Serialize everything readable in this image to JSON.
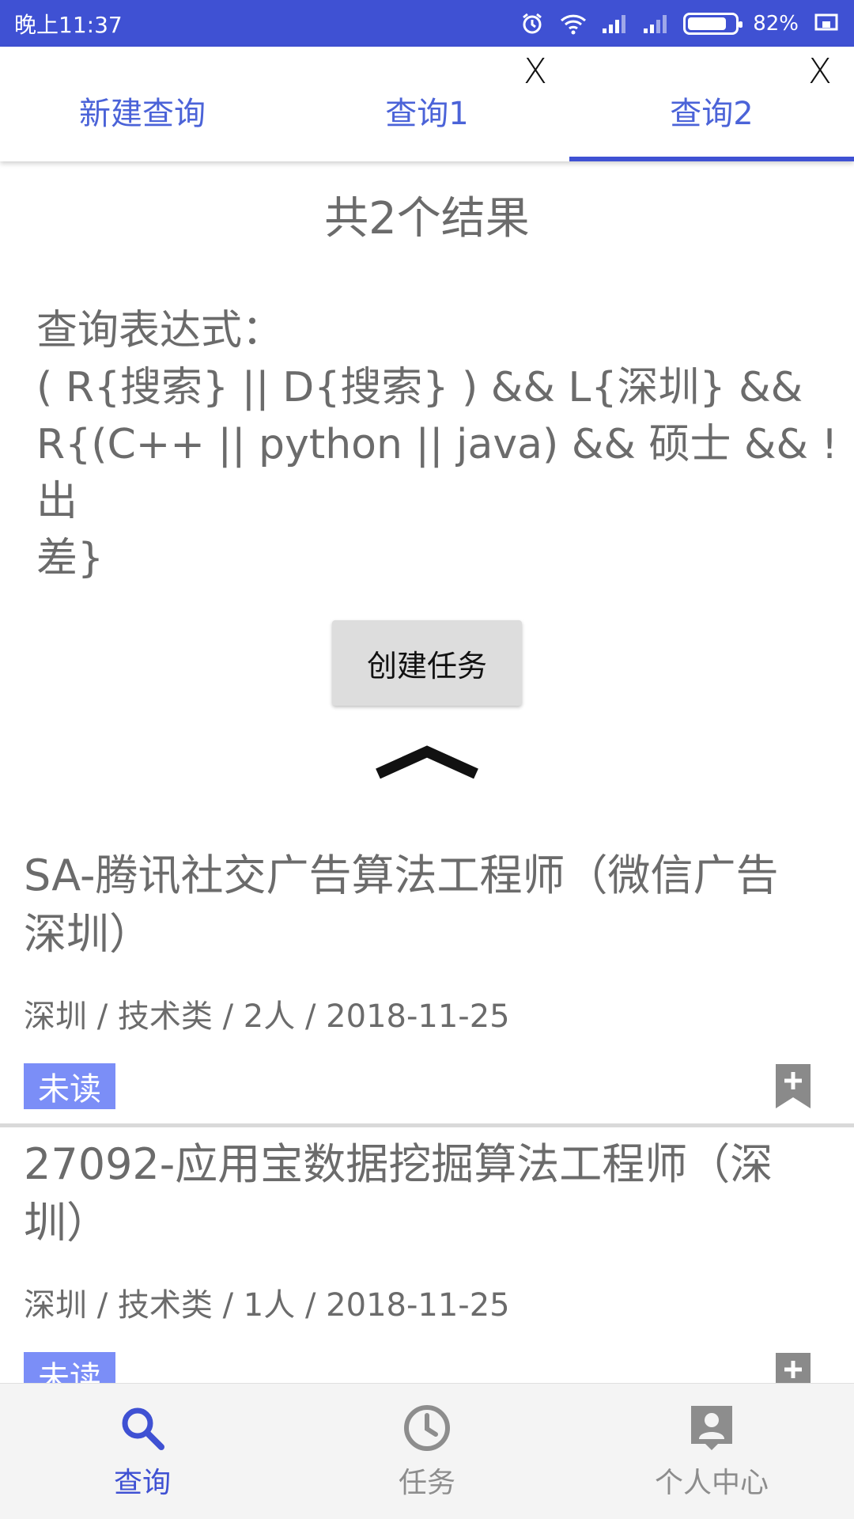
{
  "status_bar": {
    "time": "晚上11:37",
    "battery": "82%",
    "battery_level": 0.82,
    "icons": [
      "alarm-icon",
      "wifi-icon",
      "signal-icon",
      "signal-icon-2",
      "battery-icon",
      "screen-icon"
    ]
  },
  "tabs": [
    {
      "label": "新建查询",
      "closable": false,
      "active": false
    },
    {
      "label": "查询1",
      "closable": true,
      "active": false
    },
    {
      "label": "查询2",
      "closable": true,
      "active": true
    }
  ],
  "tab_close_label": "X",
  "main": {
    "result_count": "共2个结果",
    "expression": "查询表达式：\n( R{搜索} || D{搜索} ) && L{深圳} &&\nR{(C++ || python || java) && 硕士 && !出\n差}",
    "create_task_label": "创建任务",
    "collapse_icon": "chevron-up-icon"
  },
  "jobs": [
    {
      "title": "SA-腾讯社交广告算法工程师（微信广告\n深圳）",
      "meta": "深圳 / 技术类 / 2人 / 2018-11-25",
      "badge": "未读",
      "action_icon": "bookmark-add-icon"
    },
    {
      "title": "27092-应用宝数据挖掘算法工程师（深\n圳）",
      "meta": "深圳 / 技术类 / 1人 / 2018-11-25",
      "badge": "未读",
      "action_icon": "bookmark-add-icon"
    }
  ],
  "bottom_nav": [
    {
      "label": "查询",
      "icon": "search-icon",
      "active": true
    },
    {
      "label": "任务",
      "icon": "clock-icon",
      "active": false
    },
    {
      "label": "个人中心",
      "icon": "person-icon",
      "active": false
    }
  ],
  "colors": {
    "accent": "#3f51d3",
    "tab_text": "#4b63d8",
    "badge": "#7b8ef7",
    "body_text": "#6b6b6b"
  }
}
